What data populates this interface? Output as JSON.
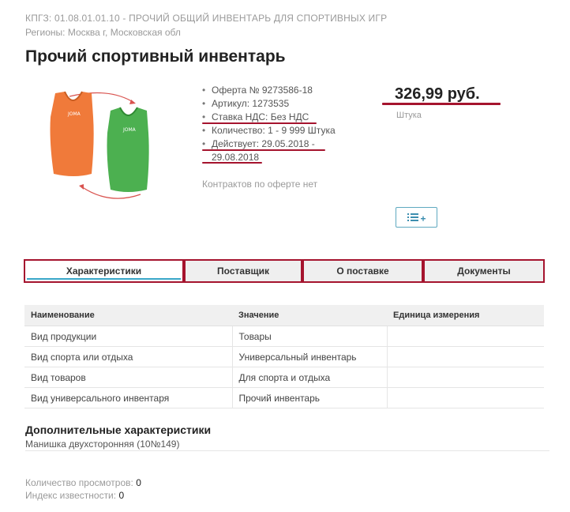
{
  "header": {
    "kpgz": "КПГЗ: 01.08.01.01.10 - ПРОЧИЙ ОБЩИЙ ИНВЕНТАРЬ ДЛЯ СПОРТИВНЫХ ИГР",
    "regions": "Регионы: Москва г, Московская обл",
    "title": "Прочий спортивный инвентарь"
  },
  "product": {
    "image_icon": "sports-bibs-image",
    "offer_items": [
      "Оферта № 9273586-18",
      "Артикул: 1273535",
      "Ставка НДС: Без НДС",
      "Количество: 1 - 9 999 Штука",
      "Действует: 29.05.2018 - 29.08.2018"
    ],
    "no_contracts": "Контрактов по оферте нет",
    "price": "326,99 руб.",
    "unit": "Штука",
    "compare_icon": "list-plus-icon",
    "accent_color": "#a5142e"
  },
  "tabs": [
    {
      "label": "Характеристики",
      "active": true
    },
    {
      "label": "Поставщик",
      "active": false
    },
    {
      "label": "О поставке",
      "active": false
    },
    {
      "label": "Документы",
      "active": false
    }
  ],
  "table": {
    "headers": [
      "Наименование",
      "Значение",
      "Единица измерения"
    ],
    "rows": [
      [
        "Вид продукции",
        "Товары",
        ""
      ],
      [
        "Вид спорта или отдыха",
        "Универсальный инвентарь",
        ""
      ],
      [
        "Вид товаров",
        "Для спорта и отдыха",
        ""
      ],
      [
        "Вид универсального инвентаря",
        "Прочий инвентарь",
        ""
      ]
    ]
  },
  "additional": {
    "heading": "Дополнительные характеристики",
    "value": "Манишка двухсторонняя (10№149)"
  },
  "stats": {
    "views_label": "Количество просмотров:",
    "views_value": "0",
    "popularity_label": "Индекс известности:",
    "popularity_value": "0"
  }
}
